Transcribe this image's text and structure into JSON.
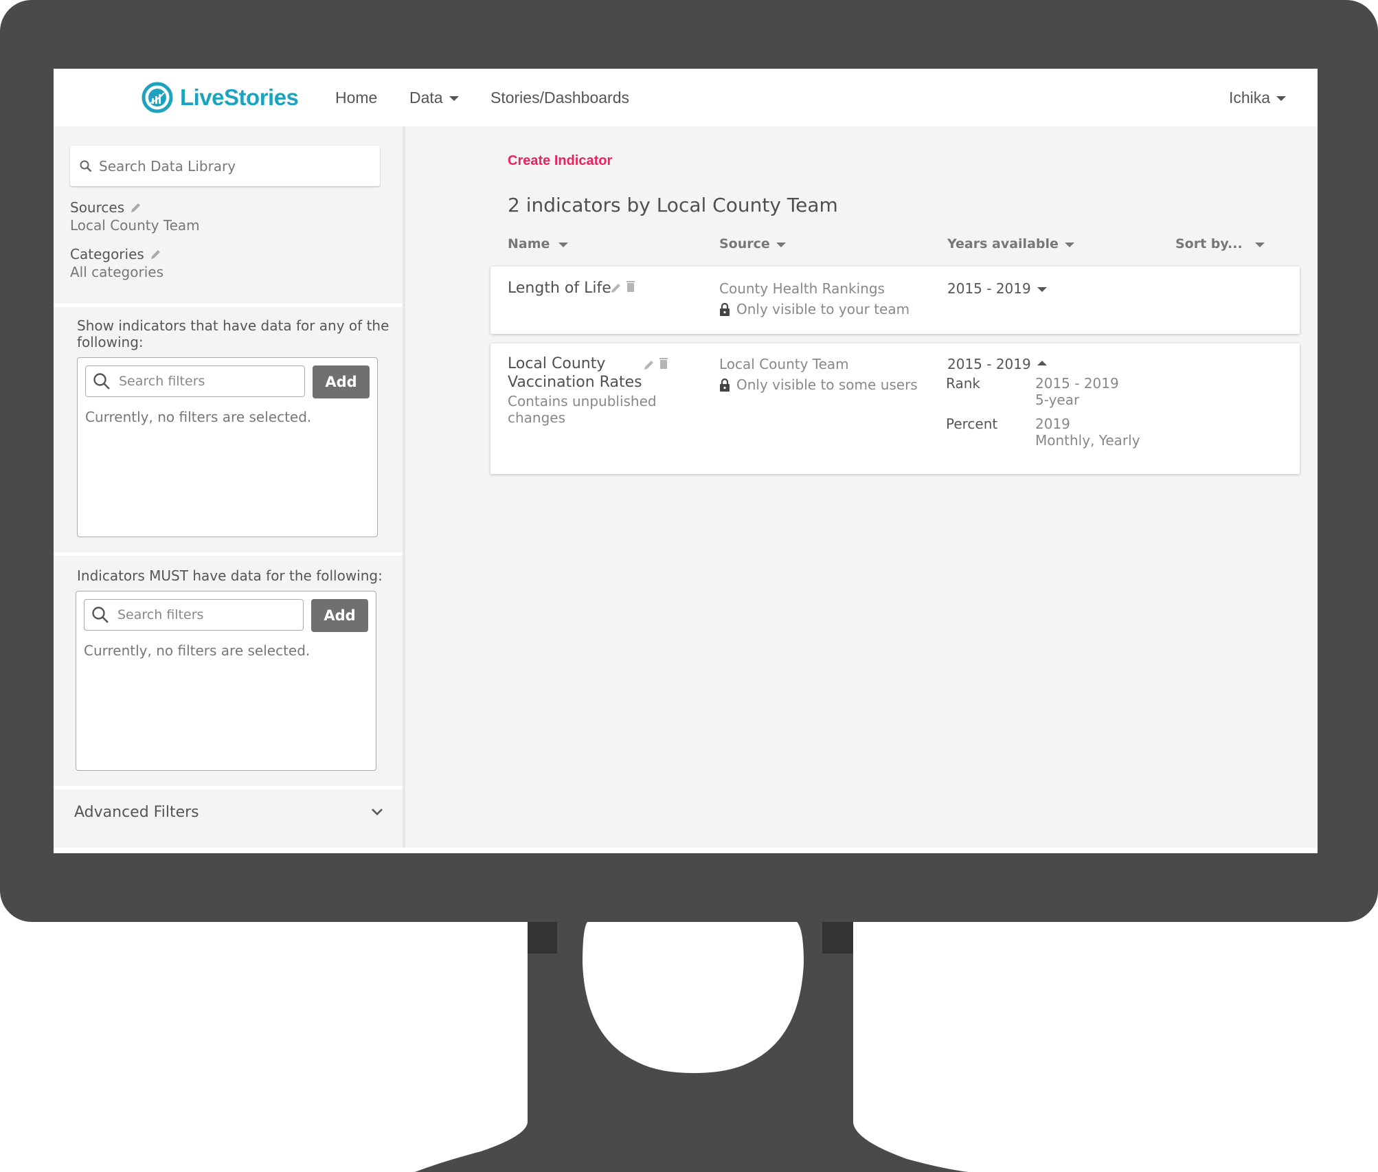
{
  "header": {
    "brand": "LiveStories",
    "nav": [
      {
        "label": "Home",
        "has_caret": false
      },
      {
        "label": "Data",
        "has_caret": true
      },
      {
        "label": "Stories/Dashboards",
        "has_caret": false
      }
    ],
    "user": "Ichika"
  },
  "sidebar": {
    "search": {
      "placeholder": "Search Data Library",
      "value": ""
    },
    "sources": {
      "label": "Sources",
      "value": "Local County Team"
    },
    "categories": {
      "label": "Categories",
      "value": "All categories"
    },
    "any_filter": {
      "title": "Show indicators that have data for any of the following:",
      "search_placeholder": "Search filters",
      "add_label": "Add",
      "empty_message": "Currently, no filters are selected."
    },
    "must_filter": {
      "title": "Indicators MUST have data for the following:",
      "search_placeholder": "Search filters",
      "add_label": "Add",
      "empty_message": "Currently, no filters are selected."
    },
    "advanced_filters": {
      "label": "Advanced Filters",
      "expanded": false
    }
  },
  "main": {
    "create_link": "Create Indicator",
    "title": "2 indicators by Local County Team",
    "columns": [
      {
        "label": "Name"
      },
      {
        "label": "Source"
      },
      {
        "label": "Years available"
      },
      {
        "label": "Sort by..."
      }
    ],
    "indicators": [
      {
        "name": "Length of Life",
        "status": "",
        "source": "County Health Rankings",
        "visibility": "Only visible to your team",
        "years": "2015 - 2019",
        "expanded": false,
        "details": []
      },
      {
        "name_line1": "Local County",
        "name_line2": "Vaccination Rates",
        "name": "Local County Vaccination Rates",
        "status_line1": "Contains unpublished",
        "status_line2": "changes",
        "source": "Local County Team",
        "visibility": "Only visible to some users",
        "years": "2015 - 2019",
        "expanded": true,
        "details": [
          {
            "measure": "Rank",
            "range": "2015 - 2019",
            "frequency": "5-year"
          },
          {
            "measure": "Percent",
            "range": "2019",
            "frequency": "Monthly, Yearly"
          }
        ]
      }
    ]
  },
  "colors": {
    "brand": "#1da3be",
    "accent": "#e8245e",
    "frame": "#4a4a4a",
    "button": "#707070"
  }
}
